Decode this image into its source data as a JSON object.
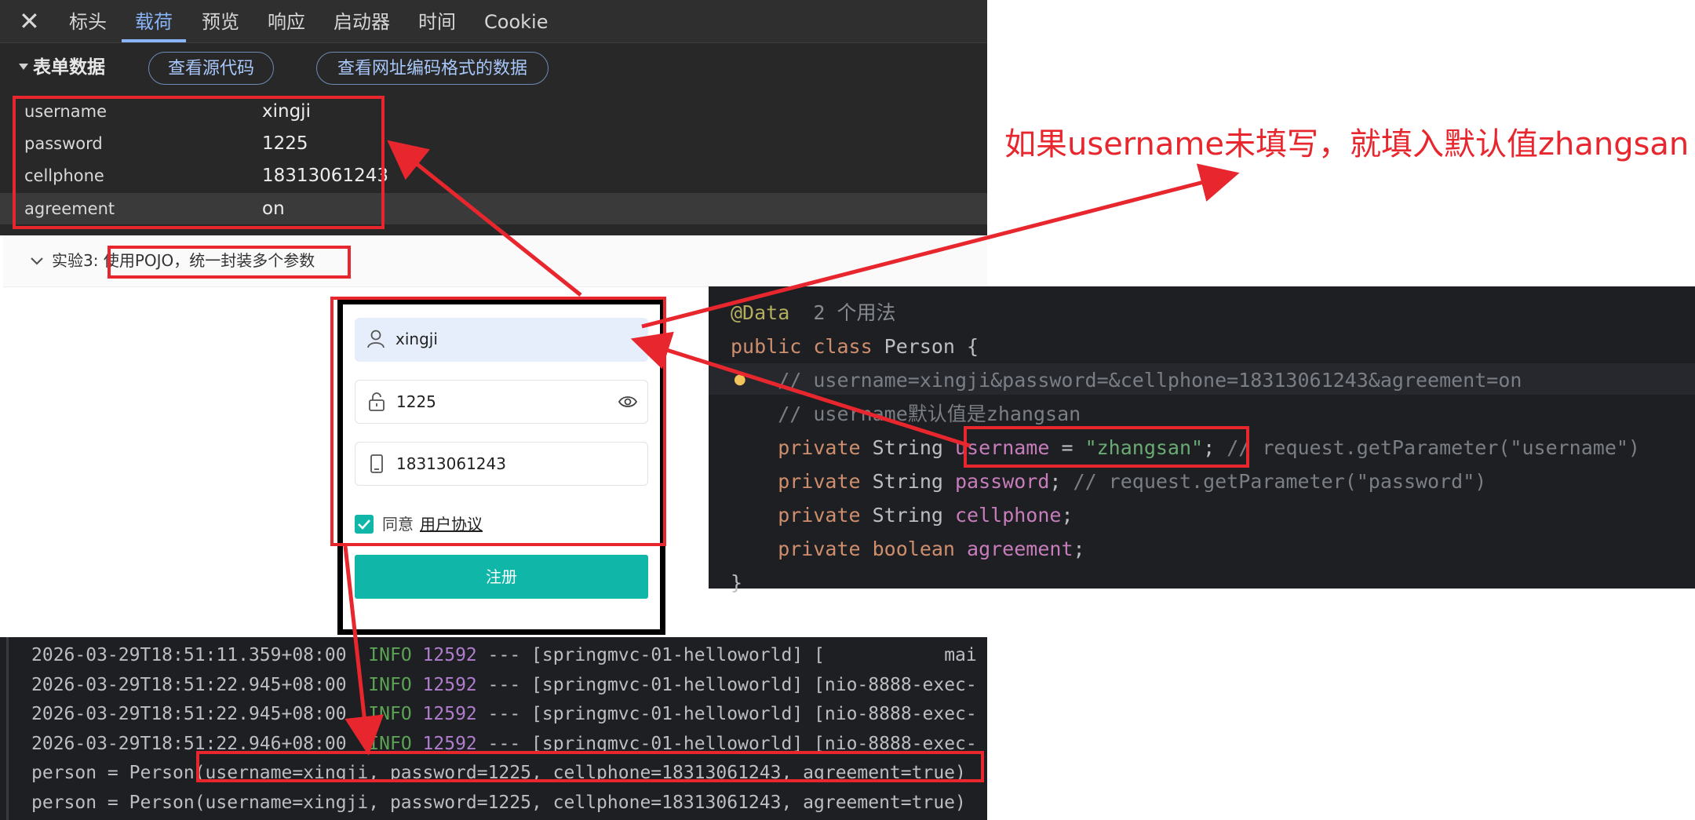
{
  "devtools": {
    "close_glyph": "✕",
    "tabs": [
      "标头",
      "载荷",
      "预览",
      "响应",
      "启动器",
      "时间",
      "Cookie"
    ],
    "active_tab": "载荷",
    "form_section_title": "表单数据",
    "view_source_button": "查看源代码",
    "view_url_encoded_button": "查看网址编码格式的数据",
    "form_fields": [
      {
        "key": "username",
        "value": "xingji"
      },
      {
        "key": "password",
        "value": "1225"
      },
      {
        "key": "cellphone",
        "value": "18313061243"
      },
      {
        "key": "agreement",
        "value": "on"
      }
    ]
  },
  "webpage": {
    "experiment_title": "实验3: 使用POJO，统一封装多个参数",
    "form": {
      "username_value": "xingji",
      "password_value": "1225",
      "cellphone_value": "18313061243",
      "agree_label": "同意",
      "agreement_link": "用户协议",
      "agree_checked": true,
      "register_button": "注册"
    }
  },
  "editor": {
    "lines": [
      {
        "parts": [
          [
            "ann",
            "@Data"
          ],
          [
            "hint",
            "  2 个用法"
          ]
        ]
      },
      {
        "parts": [
          [
            "kw",
            "public class "
          ],
          [
            "cls",
            "Person "
          ],
          [
            "plain",
            "{"
          ]
        ]
      },
      {
        "parts": [
          [
            "cmt",
            "    // username=xingji&password=&cellphone=18313061243&agreement=on"
          ]
        ]
      },
      {
        "parts": [
          [
            "cmt",
            "    // username默认值是zhangsan"
          ]
        ]
      },
      {
        "parts": [
          [
            "kw",
            "    private "
          ],
          [
            "cls",
            "String "
          ],
          [
            "fld",
            "username"
          ],
          [
            "plain",
            " = "
          ],
          [
            "str",
            "\"zhangsan\""
          ],
          [
            "plain",
            "; "
          ],
          [
            "cmt",
            "// request.getParameter(\"username\")"
          ]
        ]
      },
      {
        "parts": [
          [
            "kw",
            "    private "
          ],
          [
            "cls",
            "String "
          ],
          [
            "fld",
            "password"
          ],
          [
            "plain",
            "; "
          ],
          [
            "cmt",
            "// request.getParameter(\"password\")"
          ]
        ]
      },
      {
        "parts": [
          [
            "kw",
            "    private "
          ],
          [
            "cls",
            "String "
          ],
          [
            "fld",
            "cellphone"
          ],
          [
            "plain",
            ";"
          ]
        ]
      },
      {
        "parts": [
          [
            "kw",
            "    private boolean "
          ],
          [
            "fld",
            "agreement"
          ],
          [
            "plain",
            ";"
          ]
        ]
      },
      {
        "parts": [
          [
            "plain",
            "}"
          ]
        ]
      }
    ]
  },
  "console": {
    "log_lines": [
      {
        "ts": "2026-03-29T18:51:11.359+08:00",
        "level": "INFO",
        "pid": "12592",
        "rest": " --- [springmvc-01-helloworld] [           mai"
      },
      {
        "ts": "2026-03-29T18:51:22.945+08:00",
        "level": "INFO",
        "pid": "12592",
        "rest": " --- [springmvc-01-helloworld] [nio-8888-exec-"
      },
      {
        "ts": "2026-03-29T18:51:22.945+08:00",
        "level": "INFO",
        "pid": "12592",
        "rest": " --- [springmvc-01-helloworld] [nio-8888-exec-"
      },
      {
        "ts": "2026-03-29T18:51:22.946+08:00",
        "level": "INFO",
        "pid": "12592",
        "rest": " --- [springmvc-01-helloworld] [nio-8888-exec-"
      }
    ],
    "output_lines": [
      "person = Person(username=xingji, password=1225, cellphone=18313061243, agreement=true)",
      "person = Person(username=xingji, password=1225, cellphone=18313061243, agreement=true)"
    ]
  },
  "annotation": {
    "callout": "如果username未填写，就填入默认值zhangsan",
    "color": "#e8262d"
  }
}
